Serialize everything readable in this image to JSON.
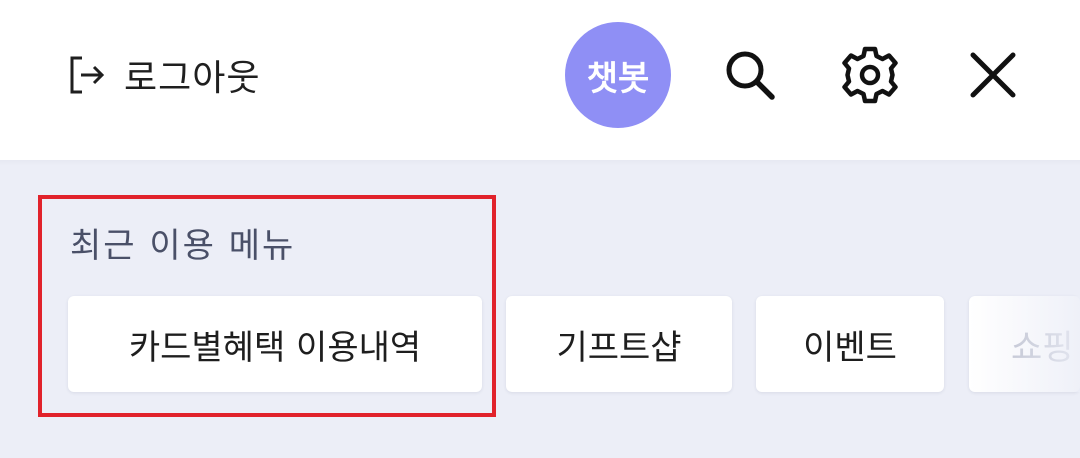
{
  "header": {
    "logout_label": "로그아웃",
    "chatbot_label": "챗봇",
    "chatbot_color": "#8f8ff5",
    "icons": {
      "logout": "logout-icon",
      "search": "search-icon",
      "settings": "gear-icon",
      "close": "close-icon"
    }
  },
  "recent": {
    "title": "최근 이용 메뉴",
    "items": [
      {
        "label": "카드별혜택 이용내역"
      },
      {
        "label": "기프트샵"
      },
      {
        "label": "이벤트"
      },
      {
        "label": "쇼핑"
      }
    ],
    "highlight_color": "#e1222b"
  }
}
